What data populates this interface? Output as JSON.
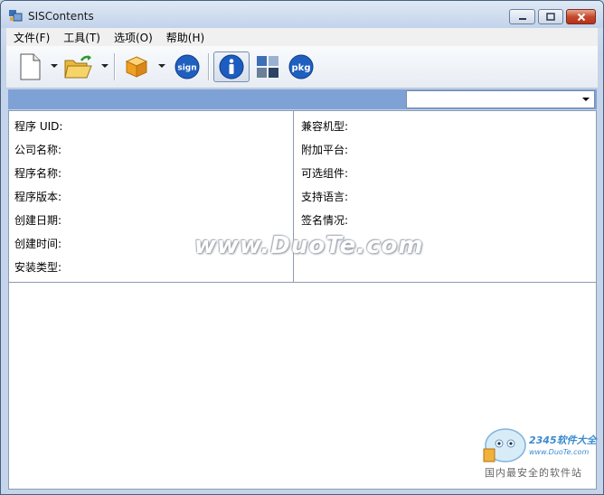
{
  "window": {
    "title": "SISContents"
  },
  "menu": {
    "items": [
      "文件(F)",
      "工具(T)",
      "选项(O)",
      "帮助(H)"
    ]
  },
  "toolbar": {
    "sign_label": "sign",
    "pkg_label": "pkg"
  },
  "info": {
    "left": [
      "程序 UID:",
      "公司名称:",
      "程序名称:",
      "程序版本:",
      "创建日期:",
      "创建时间:",
      "安装类型:"
    ],
    "right": [
      "兼容机型:",
      "附加平台:",
      "可选组件:",
      "支持语言:",
      "签名情况:"
    ]
  },
  "watermark": {
    "text": "www.DuoTe.com"
  },
  "brand": {
    "line1": "2345软件大全",
    "line2": "www.DuoTe.com",
    "line3": "国内最安全的软件站"
  },
  "colors": {
    "accent_bar": "#7ea2d6",
    "close_button": "#c54a2d",
    "sign_icon": "#1f5fbf",
    "package_icon": "#f0a020"
  }
}
